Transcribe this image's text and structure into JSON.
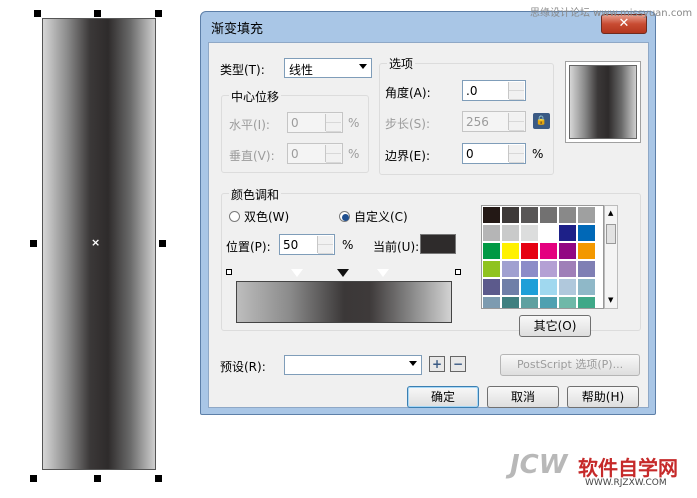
{
  "dialog": {
    "title": "渐变填充",
    "close": "✕",
    "type_label": "类型(T):",
    "type_value": "线性",
    "options_group": "选项",
    "center_group": "中心位移",
    "horizontal_label": "水平(I):",
    "horizontal_value": "0",
    "vertical_label": "垂直(V):",
    "vertical_value": "0",
    "percent": "%",
    "angle_label": "角度(A):",
    "angle_value": ".0",
    "steps_label": "步长(S):",
    "steps_value": "256",
    "edge_label": "边界(E):",
    "edge_value": "0",
    "color_group": "颜色调和",
    "two_color_label": "双色(W)",
    "custom_label": "自定义(C)",
    "position_label": "位置(P):",
    "position_value": "50",
    "current_label": "当前(U):",
    "current_color": "#2e2b2b",
    "other_button": "其它(O)",
    "preset_label": "预设(R):",
    "preset_value": "",
    "postscript_button": "PostScript 选项(P)...",
    "ok_button": "确定",
    "cancel_button": "取消",
    "help_button": "帮助(H)",
    "palette": [
      "#231815",
      "#3e3a39",
      "#595757",
      "#727171",
      "#898989",
      "#9fa0a0",
      "#b5b5b6",
      "#c9caca",
      "#dcdddd",
      "#ffffff",
      "#1d2088",
      "#0068b7",
      "#009944",
      "#fff100",
      "#e60012",
      "#e4007f",
      "#920783",
      "#f39800",
      "#8fc31f",
      "#a0a0d0",
      "#8c8cc8",
      "#b4a0d4",
      "#9f7fb8",
      "#7f7fb4",
      "#5c5a8c",
      "#6f7fa8",
      "#1f9fd8",
      "#a0d8ef",
      "#b0c8dc",
      "#8fb8c8",
      "#7d9bb0",
      "#3f7f7f",
      "#5fa0a0",
      "#4fa0b0",
      "#6fb8a8",
      "#3fa888",
      "#2f8878"
    ]
  },
  "watermark": {
    "top": "思缘设计论坛 www.missyuan.com",
    "brand": "JCW",
    "site": "软件自学网",
    "url": "WWW.RJZXW.COM"
  }
}
